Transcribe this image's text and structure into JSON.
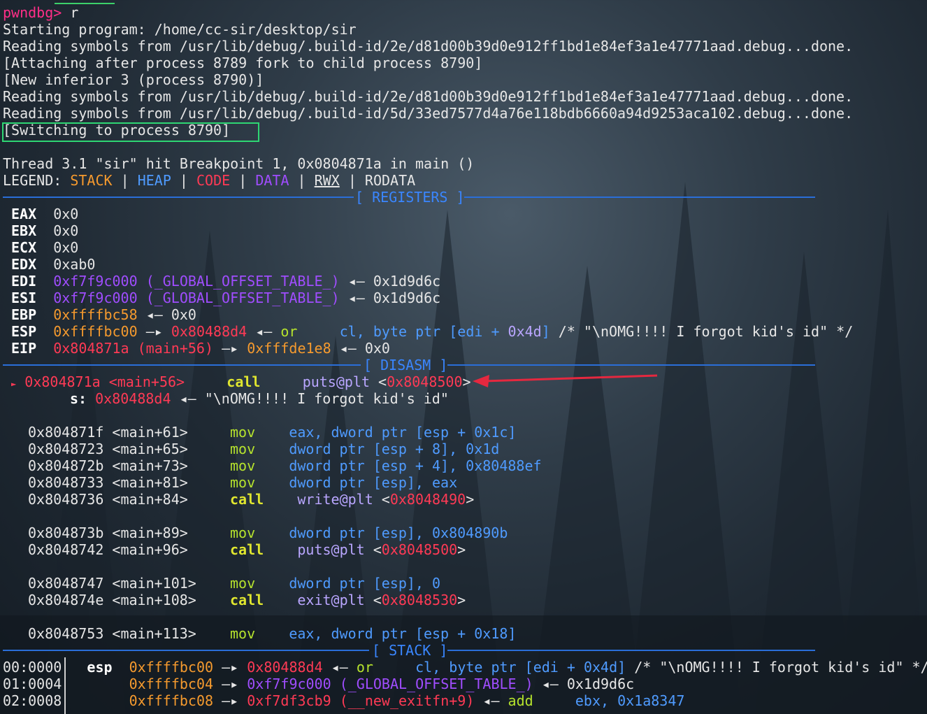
{
  "prompt": "pwndbg>",
  "command": "r",
  "output": {
    "starting": "Starting program: /home/cc-sir/desktop/sir",
    "read1": "Reading symbols from /usr/lib/debug/.build-id/2e/d81d00b39d0e912ff1bd1e84ef3a1e47771aad.debug...done.",
    "attach": "[Attaching after process 8789 fork to child process 8790]",
    "inferior": "[New inferior 3 (process 8790)]",
    "read2": "Reading symbols from /usr/lib/debug/.build-id/2e/d81d00b39d0e912ff1bd1e84ef3a1e47771aad.debug...done.",
    "read3": "Reading symbols from /usr/lib/debug/.build-id/5d/33ed7577d4a76e118bdb6660a94d9253aca102.debug...done.",
    "switching": "[Switching to process 8790]",
    "thread": "Thread 3.1 \"sir\" hit Breakpoint 1, 0x0804871a in main ()"
  },
  "legend": {
    "label": "LEGEND:",
    "stack": "STACK",
    "heap": "HEAP",
    "code": "CODE",
    "data": "DATA",
    "rwx": "RWX",
    "rodata": "RODATA",
    "sep": "|"
  },
  "sections": {
    "registers": "[ REGISTERS ]",
    "disasm": "[ DISASM ]",
    "stack": "[ STACK ]"
  },
  "registers": {
    "eax": {
      "name": "EAX",
      "value": "0x0"
    },
    "ebx": {
      "name": "EBX",
      "value": "0x0"
    },
    "ecx": {
      "name": "ECX",
      "value": "0x0"
    },
    "edx": {
      "name": "EDX",
      "value": "0xab0"
    },
    "edi": {
      "name": "EDI",
      "addr": "0xf7f9c000",
      "sym": "(_GLOBAL_OFFSET_TABLE_)",
      "arrow": "◂—",
      "value": "0x1d9d6c"
    },
    "esi": {
      "name": "ESI",
      "addr": "0xf7f9c000",
      "sym": "(_GLOBAL_OFFSET_TABLE_)",
      "arrow": "◂—",
      "value": "0x1d9d6c"
    },
    "ebp": {
      "name": "EBP",
      "addr": "0xffffbc58",
      "arrow": "◂—",
      "value": "0x0"
    },
    "esp": {
      "name": "ESP",
      "addr": "0xffffbc00",
      "arrow1": "—▸",
      "addr2": "0x80488d4",
      "arrow2": "◂—",
      "op": "or",
      "args_a": "cl, byte ptr [",
      "args_reg": "edi",
      "args_b": " + ",
      "args_imm": "0x4d",
      "args_c": "]",
      "comment": "/* \"\\nOMG!!!! I forgot kid's id\" */"
    },
    "eip": {
      "name": "EIP",
      "addr": "0x804871a",
      "sym": "(main+56)",
      "arrow1": "—▸",
      "addr2": "0xfffde1e8",
      "arrow2": "◂—",
      "value": "0x0"
    }
  },
  "disasm": {
    "current": {
      "marker": "►",
      "addr": "0x804871a",
      "sym": "<main+56>",
      "op": "call",
      "target": "puts@plt",
      "target_addr": "0x8048500"
    },
    "arg": {
      "name": "s:",
      "addr": "0x80488d4",
      "arrow": "◂—",
      "value": "\"\\nOMG!!!! I forgot kid's id\""
    },
    "lines": [
      {
        "addr": "0x804871f",
        "sym": "<main+61>",
        "op": "mov",
        "args": "eax, dword ptr [esp + 0x1c]"
      },
      {
        "addr": "0x8048723",
        "sym": "<main+65>",
        "op": "mov",
        "args": "dword ptr [esp + 8], 0x1d"
      },
      {
        "addr": "0x804872b",
        "sym": "<main+73>",
        "op": "mov",
        "args": "dword ptr [esp + 4], 0x80488ef"
      },
      {
        "addr": "0x8048733",
        "sym": "<main+81>",
        "op": "mov",
        "args": "dword ptr [esp], eax"
      },
      {
        "addr": "0x8048736",
        "sym": "<main+84>",
        "op": "call",
        "args": "write@plt",
        "target_addr": "0x8048490"
      },
      {
        "addr": "0x804873b",
        "sym": "<main+89>",
        "op": "mov",
        "args": "dword ptr [esp], 0x804890b"
      },
      {
        "addr": "0x8048742",
        "sym": "<main+96>",
        "op": "call",
        "args": "puts@plt",
        "target_addr": "0x8048500"
      },
      {
        "addr": "0x8048747",
        "sym": "<main+101>",
        "op": "mov",
        "args": "dword ptr [esp], 0"
      },
      {
        "addr": "0x804874e",
        "sym": "<main+108>",
        "op": "call",
        "args": "exit@plt",
        "target_addr": "0x8048530"
      },
      {
        "addr": "0x8048753",
        "sym": "<main+113>",
        "op": "mov",
        "args": "eax, dword ptr [esp + 0x18]"
      }
    ]
  },
  "stack": [
    {
      "idx": "00:0000",
      "reg": "esp",
      "addr": "0xffffbc00",
      "arrow": "—▸",
      "val": "0x80488d4",
      "arrow2": "◂—",
      "op": "or",
      "args": "cl, byte ptr [edi + 0x4d]",
      "comment": "/* \"\\nOMG!!!! I forgot kid's id\" */"
    },
    {
      "idx": "01:0004",
      "addr": "0xffffbc04",
      "arrow": "—▸",
      "val": "0xf7f9c000",
      "sym": "(_GLOBAL_OFFSET_TABLE_)",
      "arrow2": "◂—",
      "value": "0x1d9d6c"
    },
    {
      "idx": "02:0008",
      "addr": "0xffffbc08",
      "arrow": "—▸",
      "val": "0xf7df3cb9",
      "sym": "(__new_exitfn+9)",
      "arrow2": "◂—",
      "op": "add",
      "args": "ebx, 0x1a8347"
    }
  ],
  "colors": {
    "prompt": "#ff2e88",
    "stack": "#f59a2e",
    "heap": "#4f9bff",
    "code": "#ff3a55",
    "data": "#a04dff",
    "separator": "#2a6ed8",
    "highlight_box": "#2ed673",
    "annotation_arrow": "#e5283f"
  }
}
